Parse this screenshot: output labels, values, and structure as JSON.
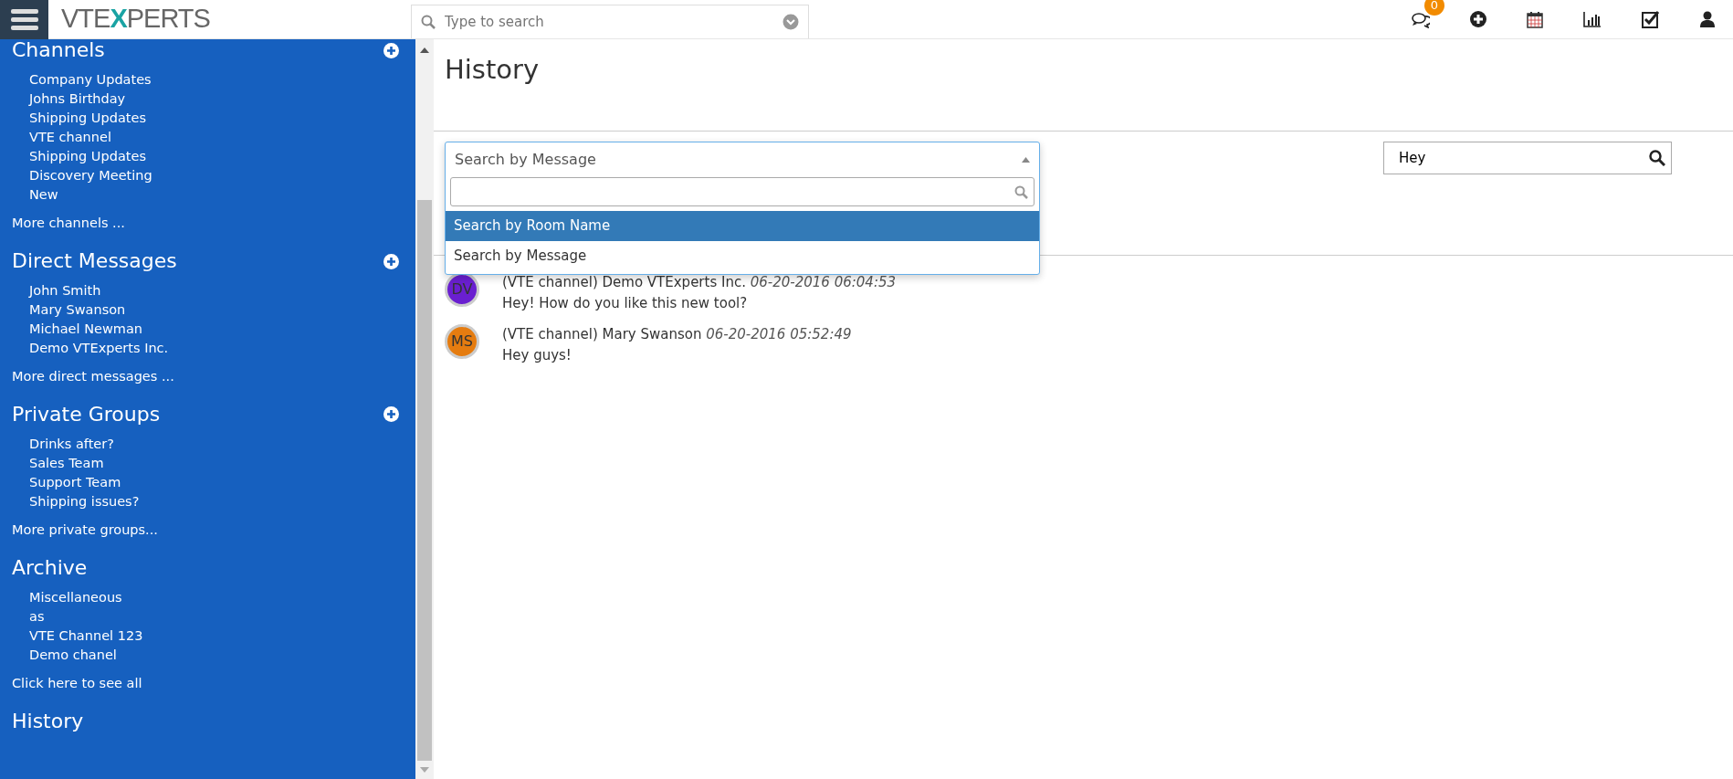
{
  "header": {
    "logo": [
      {
        "text": "VTE",
        "accent": false
      },
      {
        "text": "X",
        "accent": true
      },
      {
        "text": "PERTS",
        "accent": false
      }
    ],
    "search": {
      "placeholder": "Type to search"
    },
    "chat_badge": "0"
  },
  "sidebar": {
    "sections": [
      {
        "title": "Channels",
        "add": true,
        "items": [
          "Company Updates",
          "Johns Birthday",
          "Shipping Updates",
          "VTE channel",
          "Shipping Updates",
          "Discovery Meeting",
          "New"
        ],
        "more": "More channels ..."
      },
      {
        "title": "Direct Messages",
        "add": true,
        "items": [
          "John Smith",
          "Mary Swanson",
          "Michael Newman",
          "Demo VTExperts Inc."
        ],
        "more": "More direct messages ..."
      },
      {
        "title": "Private Groups",
        "add": true,
        "items": [
          "Drinks after?",
          "Sales Team",
          "Support Team",
          "Shipping issues?"
        ],
        "more": "More private groups..."
      },
      {
        "title": "Archive",
        "add": false,
        "items": [
          "Miscellaneous",
          "as",
          "VTE Channel 123",
          "Demo chanel"
        ],
        "more": "Click here to see all"
      },
      {
        "title": "History",
        "add": false
      }
    ]
  },
  "main": {
    "title": "History",
    "filter": {
      "value": "Search by Message",
      "open": true,
      "options": [
        {
          "label": "Search by Room Name",
          "highlighted": true
        },
        {
          "label": "Search by Message",
          "highlighted": false
        }
      ]
    },
    "search": {
      "value": "Hey"
    },
    "messages": [
      {
        "initials": "DV",
        "color": "#6a1fd0",
        "sender": "(VTE channel) Demo VTExperts Inc.",
        "time": "06-20-2016 06:04:53",
        "text": "Hey! How do you like this new tool?"
      },
      {
        "initials": "MS",
        "color": "#e57c10",
        "sender": "(VTE channel) Mary Swanson",
        "time": "06-20-2016 05:52:49",
        "text": "Hey guys!"
      }
    ]
  }
}
